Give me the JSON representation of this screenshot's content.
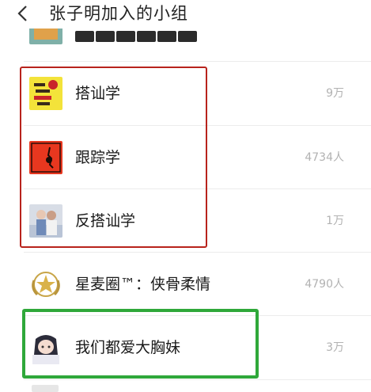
{
  "header": {
    "back_icon": "chevron-left-icon",
    "title": "张子明加入的小组"
  },
  "groups": [
    {
      "name": "搭讪学",
      "count": "9万",
      "icon": "book-cover-icon"
    },
    {
      "name": "跟踪学",
      "count": "4734人",
      "icon": "red-square-icon"
    },
    {
      "name": "反搭讪学",
      "count": "1万",
      "icon": "photo-couple-icon"
    },
    {
      "name": "星麦圈™：侠骨柔情",
      "count": "4790人",
      "icon": "gold-star-emblem-icon"
    },
    {
      "name": "我们都爱大胸妹",
      "count": "3万",
      "icon": "anime-avatar-icon"
    }
  ],
  "annotations": {
    "red_box_color": "#b8231c",
    "green_box_color": "#2fa83a"
  }
}
